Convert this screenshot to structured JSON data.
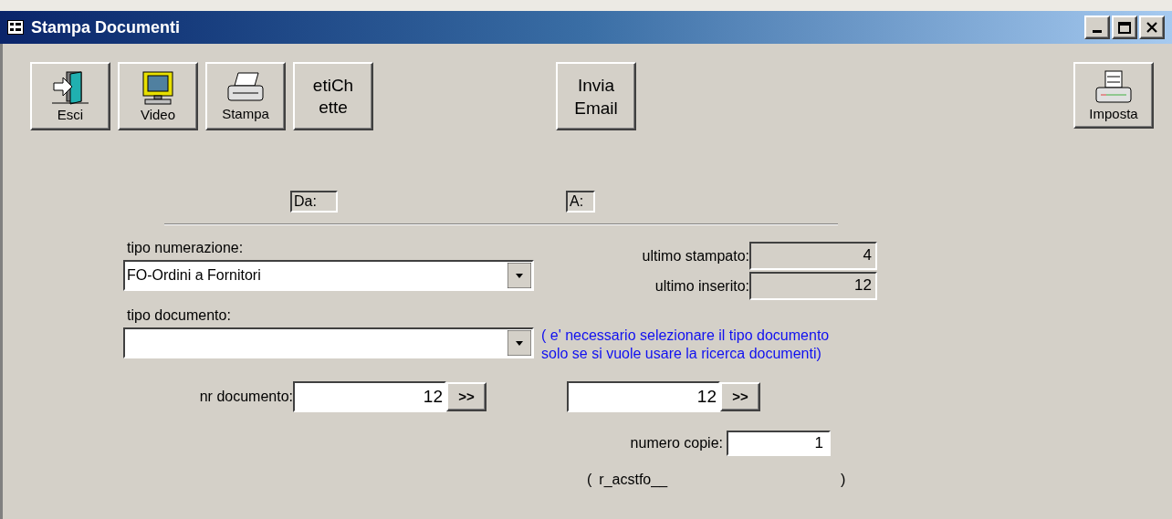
{
  "window": {
    "title": "Stampa Documenti"
  },
  "toolbar": [
    {
      "kind": "exit",
      "label": "Esci"
    },
    {
      "kind": "video",
      "label": "Video"
    },
    {
      "kind": "print",
      "label": "Stampa"
    },
    {
      "kind": "text",
      "label_lines": [
        "etiCh",
        "ette"
      ]
    }
  ],
  "email_button": {
    "label_lines": [
      "Invia",
      "Email"
    ]
  },
  "setup_button": {
    "label": "Imposta"
  },
  "range_headers": {
    "from": "Da:",
    "to": "A:"
  },
  "numbering": {
    "label": "tipo numerazione:",
    "value": "FO-Ordini a Fornitori"
  },
  "last_printed": {
    "label": "ultimo stampato:",
    "value": "4"
  },
  "last_inserted": {
    "label": "ultimo inserito:",
    "value": "12"
  },
  "document_type": {
    "label": "tipo documento:"
  },
  "note_lines": [
    "( e' necessario selezionare il tipo documento",
    "solo se si vuole usare la ricerca documenti)"
  ],
  "document_number": {
    "label": "nr documento:",
    "from": "12",
    "from_button": ">>",
    "to": "12",
    "to_button": ">>"
  },
  "copies": {
    "label": "numero copie:",
    "value": "1"
  },
  "report": {
    "open": "(",
    "name": "r_acstfo__",
    "close": ")"
  }
}
